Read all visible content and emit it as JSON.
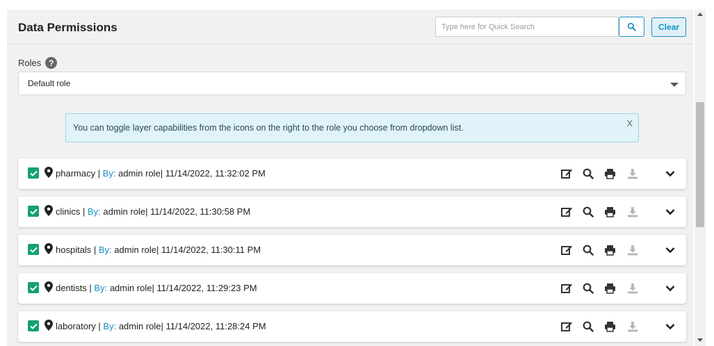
{
  "header": {
    "title": "Data Permissions",
    "search_placeholder": "Type here for Quick Search",
    "clear_label": "Clear"
  },
  "roles": {
    "label": "Roles",
    "help_glyph": "?",
    "selected": "Default role"
  },
  "info": {
    "message": "You can toggle layer capabilities from the icons on the right to the role you choose from dropdown list.",
    "close_label": "X"
  },
  "layers": [
    {
      "name": "pharmacy",
      "sep": " | ",
      "by_label": "By:",
      "author": " admin role",
      "timestamp": "| 11/14/2022, 11:32:02 PM"
    },
    {
      "name": "clinics",
      "sep": " | ",
      "by_label": "By:",
      "author": " admin role",
      "timestamp": "| 11/14/2022, 11:30:58 PM"
    },
    {
      "name": "hospitals",
      "sep": " | ",
      "by_label": "By:",
      "author": " admin role",
      "timestamp": "| 11/14/2022, 11:30:11 PM"
    },
    {
      "name": "dentists",
      "sep": " | ",
      "by_label": "By:",
      "author": " admin role",
      "timestamp": "| 11/14/2022, 11:29:23 PM"
    },
    {
      "name": "laboratory",
      "sep": " | ",
      "by_label": "By:",
      "author": " admin role",
      "timestamp": "| 11/14/2022, 11:28:24 PM"
    }
  ],
  "icons": {
    "checkbox": "check-icon",
    "pin": "map-marker-icon",
    "edit": "edit-icon",
    "search": "search-icon",
    "print": "print-icon",
    "download": "download-icon",
    "expand": "chevron-down-icon"
  },
  "colors": {
    "accent": "#1a8fc4",
    "checkbox": "#16a16f",
    "info_bg": "#dff3f8",
    "panel_bg": "#f1f1f1"
  }
}
